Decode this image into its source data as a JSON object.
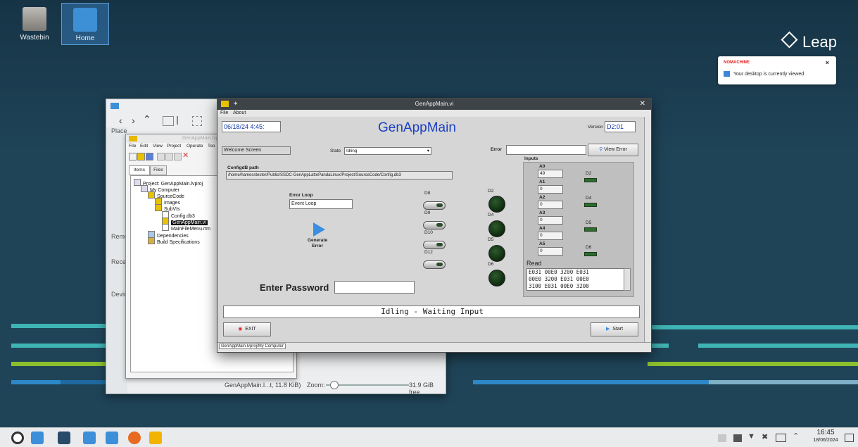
{
  "desktop": {
    "icons": [
      {
        "label": "Wastebin"
      },
      {
        "label": "Home"
      }
    ],
    "brand": "Leap"
  },
  "notification": {
    "app": "NOMACHINE",
    "message": "Your desktop is currently viewed",
    "close": "×"
  },
  "filemanager": {
    "sidebar_sections": [
      "Place",
      "Remo",
      "Rece",
      "Devic"
    ],
    "status_text": "GenAppMain.l...t, 11.8 KiB)",
    "zoom_label": "Zoom:",
    "free_space": "31.9 GiB free"
  },
  "project": {
    "title": "GenAppMain.lvproj",
    "menu": [
      "File",
      "Edit",
      "View",
      "Project",
      "Operate",
      "Too"
    ],
    "tabs": [
      "Items",
      "Files"
    ],
    "tree": [
      {
        "label": "Project: GenAppMain.lvproj"
      },
      {
        "label": "My Computer"
      },
      {
        "label": "SourceCode"
      },
      {
        "label": "Images"
      },
      {
        "label": "SubVIs"
      },
      {
        "label": "Config.db3"
      },
      {
        "label": "GenAppMain.vi"
      },
      {
        "label": "MainFileMenu.rtm"
      },
      {
        "label": "Dependencies"
      },
      {
        "label": "Build Specifications"
      }
    ]
  },
  "lv": {
    "title": "GenAppMain.vi",
    "menu": [
      "File",
      "About"
    ],
    "date": "06/18/24  4:45:",
    "heading": "GenAppMain",
    "version_label": "Version",
    "version": "D2:01",
    "screen_field": "Welcome Screen",
    "state_label": "State",
    "state_value": "Idling",
    "error_label": "Error",
    "error_value": "",
    "view_error": "View Error",
    "configdb_label": "ConfigdB path",
    "configdb_path": "/home/hamesstester/Public/SSDC-GenAppLattePandaLinux/Project/SourceCode/Config.db3",
    "error_loop_label": "Error Loop",
    "error_loop_value": "Event Loop",
    "generate_error": "Generate\nError",
    "switches": [
      "D8",
      "D9",
      "D10",
      "D12"
    ],
    "leds": [
      "D2",
      "D4",
      "D5",
      "D6"
    ],
    "inputs_label": "Inputs",
    "analog": [
      {
        "name": "A0",
        "value": "49"
      },
      {
        "name": "A1",
        "value": "0"
      },
      {
        "name": "A2",
        "value": "0"
      },
      {
        "name": "A3",
        "value": "0"
      },
      {
        "name": "A4",
        "value": "0"
      },
      {
        "name": "A5",
        "value": "0"
      }
    ],
    "digital_in": [
      "D2",
      "D4",
      "D5",
      "D6"
    ],
    "read_label": "Read",
    "read_lines": [
      "E031 00E0 3200 E031",
      "00E0 3200 E031 00E0",
      "3100 E031 00E0 3200"
    ],
    "password_label": "Enter Password",
    "password_value": "",
    "status_message": "Idling - Waiting Input",
    "exit": "EXIT",
    "start": "Start",
    "bottom_path": "GenAppMain.lvproj/My Computer"
  },
  "taskbar": {
    "time": "16:45",
    "date": "18/06/2024"
  }
}
